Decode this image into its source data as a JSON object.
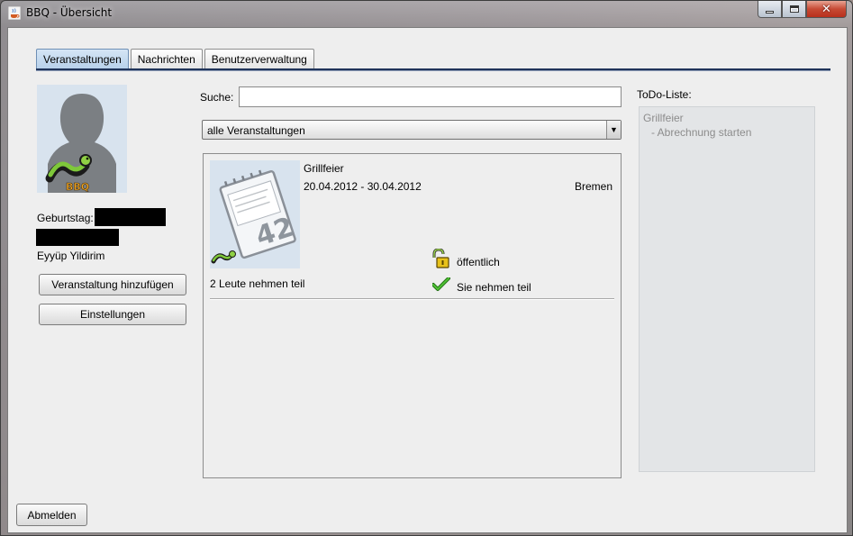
{
  "window": {
    "title": "BBQ - Übersicht",
    "close_glyph": "✕"
  },
  "tabs": [
    {
      "label": "Veranstaltungen",
      "active": true
    },
    {
      "label": "Nachrichten",
      "active": false
    },
    {
      "label": "Benutzerverwaltung",
      "active": false
    }
  ],
  "profile": {
    "birthday_label": "Geburtstag:",
    "name": "Eyyüp Yildirim",
    "add_event_button": "Veranstaltung hinzufügen",
    "settings_button": "Einstellungen",
    "avatar_logo_text": "BBQ"
  },
  "search": {
    "label": "Suche:",
    "value": ""
  },
  "filter": {
    "selected": "alle Veranstaltungen",
    "arrow": "▼"
  },
  "events": [
    {
      "title": "Grillfeier",
      "dates": "20.04.2012 - 30.04.2012",
      "location": "Bremen",
      "calendar_number": "42",
      "visibility": "öffentlich",
      "participation": "Sie nehmen teil",
      "participants": "2 Leute nehmen teil"
    }
  ],
  "todo": {
    "label": "ToDo-Liste:",
    "items": [
      {
        "text": "Grillfeier"
      },
      {
        "text": "- Abrechnung starten"
      }
    ]
  },
  "footer": {
    "logout_button": "Abmelden"
  },
  "colors": {
    "tab_active": "#b7d0ea",
    "tab_line": "#20345a",
    "close_button": "#c74a34",
    "todo_text": "#8c8c8c",
    "lock_gold": "#e8c21a",
    "check_green": "#2c9a1c"
  },
  "icons": {
    "app": "java-cup-icon",
    "avatar": "user-silhouette-icon",
    "event": "calendar-icon",
    "visibility": "unlocked-padlock-icon",
    "participation": "checkmark-icon"
  }
}
